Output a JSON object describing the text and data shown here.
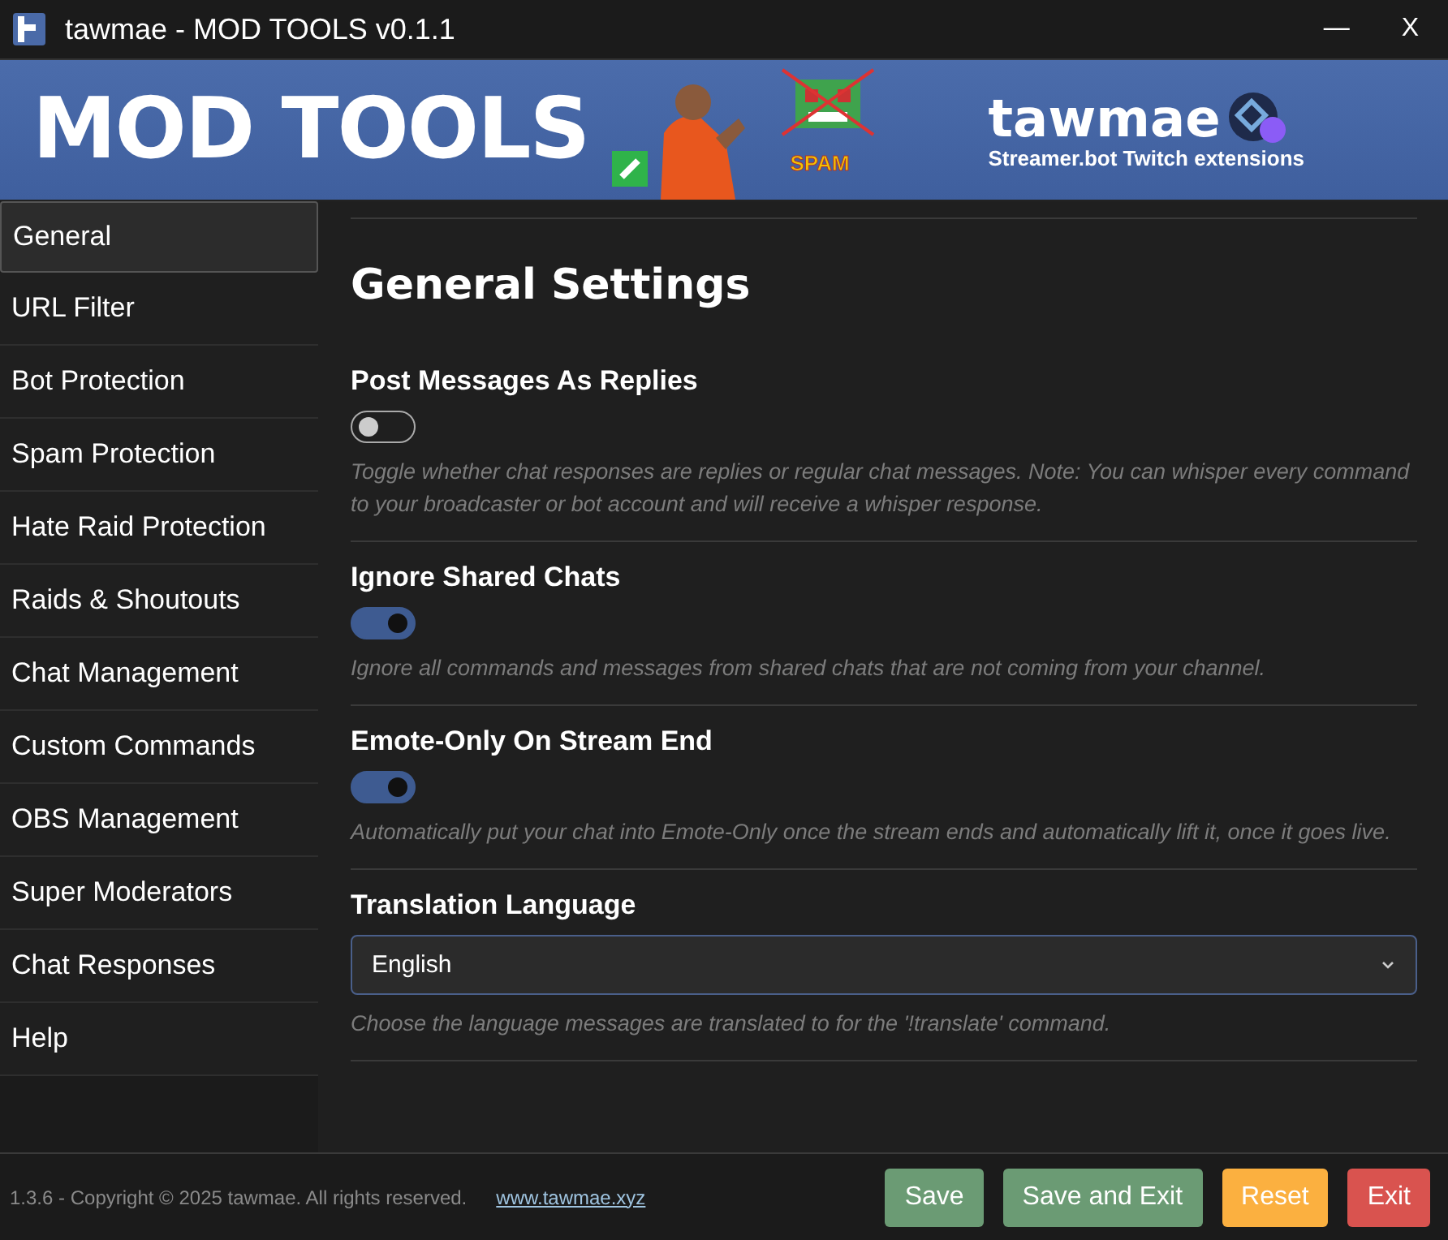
{
  "window": {
    "title": "tawmae - MOD TOOLS v0.1.1",
    "controls": [
      "—",
      "X"
    ]
  },
  "banner": {
    "title": "MOD TOOLS",
    "spam_label": "SPAM",
    "brand": "tawmae",
    "tagline": "Streamer.bot Twitch extensions"
  },
  "sidebar": {
    "items": [
      {
        "label": "General",
        "selected": true
      },
      {
        "label": "URL Filter",
        "selected": false
      },
      {
        "label": "Bot Protection",
        "selected": false
      },
      {
        "label": "Spam Protection",
        "selected": false
      },
      {
        "label": "Hate Raid Protection",
        "selected": false
      },
      {
        "label": "Raids & Shoutouts",
        "selected": false
      },
      {
        "label": "Chat Management",
        "selected": false
      },
      {
        "label": "Custom Commands",
        "selected": false
      },
      {
        "label": "OBS Management",
        "selected": false
      },
      {
        "label": "Super Moderators",
        "selected": false
      },
      {
        "label": "Chat Responses",
        "selected": false
      },
      {
        "label": "Help",
        "selected": false
      }
    ]
  },
  "content": {
    "heading": "General Settings",
    "settings": [
      {
        "kind": "toggle",
        "label": "Post Messages As Replies",
        "on": false,
        "description": "Toggle whether chat responses are replies or regular chat messages. Note: You can whisper every command to your broadcaster or bot account and will receive a whisper response."
      },
      {
        "kind": "toggle",
        "label": "Ignore Shared Chats",
        "on": true,
        "description": "Ignore all commands and messages from shared chats that are not coming from your channel."
      },
      {
        "kind": "toggle",
        "label": "Emote-Only On Stream End",
        "on": true,
        "description": "Automatically put your chat into Emote-Only once the stream ends and automatically lift it, once it goes live."
      },
      {
        "kind": "select",
        "label": "Translation Language",
        "value": "English",
        "description": "Choose the language messages are translated to for the '!translate' command."
      }
    ]
  },
  "footer": {
    "copyright": "1.3.6 - Copyright © 2025 tawmae. All rights reserved.",
    "link": "www.tawmae.xyz",
    "buttons": [
      {
        "label": "Save",
        "color": "#6b9b74"
      },
      {
        "label": "Save and Exit",
        "color": "#6b9b74"
      },
      {
        "label": "Reset",
        "color": "#fbb040"
      },
      {
        "label": "Exit",
        "color": "#d9534f"
      }
    ]
  }
}
